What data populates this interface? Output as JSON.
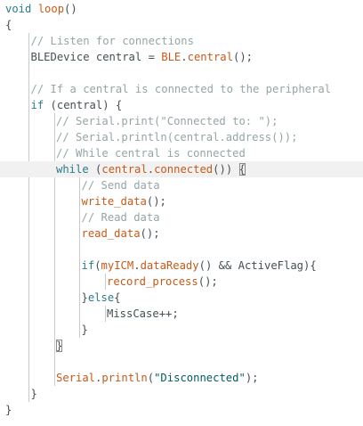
{
  "editor": {
    "lines": [
      {
        "indent": 0,
        "tokens": [
          {
            "t": "void ",
            "c": "kw"
          },
          {
            "t": "loop",
            "c": "fn"
          },
          {
            "t": "()",
            "c": "op"
          }
        ]
      },
      {
        "indent": 0,
        "tokens": [
          {
            "t": "{",
            "c": "op"
          }
        ]
      },
      {
        "indent": 1,
        "tokens": [
          {
            "t": "// Listen for connections",
            "c": "cm"
          }
        ]
      },
      {
        "indent": 1,
        "tokens": [
          {
            "t": "BLEDevice central = ",
            "c": "op"
          },
          {
            "t": "BLE",
            "c": "fn"
          },
          {
            "t": ".",
            "c": "op"
          },
          {
            "t": "central",
            "c": "fn"
          },
          {
            "t": "();",
            "c": "op"
          }
        ]
      },
      {
        "indent": 0,
        "tokens": []
      },
      {
        "indent": 1,
        "tokens": [
          {
            "t": "// If a central is connected to the peripheral",
            "c": "cm"
          }
        ]
      },
      {
        "indent": 1,
        "tokens": [
          {
            "t": "if",
            "c": "kw"
          },
          {
            "t": " (central) {",
            "c": "op"
          }
        ]
      },
      {
        "indent": 2,
        "tokens": [
          {
            "t": "// Serial.print(\"Connected to: \");",
            "c": "cm"
          }
        ]
      },
      {
        "indent": 2,
        "tokens": [
          {
            "t": "// Serial.println(central.address());",
            "c": "cm"
          }
        ]
      },
      {
        "indent": 2,
        "tokens": [
          {
            "t": "// While central is connected",
            "c": "cm"
          }
        ]
      },
      {
        "indent": 2,
        "active": true,
        "tokens": [
          {
            "t": "while",
            "c": "kw"
          },
          {
            "t": " (",
            "c": "op"
          },
          {
            "t": "central",
            "c": "fn"
          },
          {
            "t": ".",
            "c": "op"
          },
          {
            "t": "connected",
            "c": "fn"
          },
          {
            "t": "()) ",
            "c": "op"
          },
          {
            "t": "{",
            "c": "op",
            "match": true
          }
        ]
      },
      {
        "indent": 3,
        "tokens": [
          {
            "t": "// Send data",
            "c": "cm"
          }
        ]
      },
      {
        "indent": 3,
        "tokens": [
          {
            "t": "write_data",
            "c": "fn"
          },
          {
            "t": "();",
            "c": "op"
          }
        ]
      },
      {
        "indent": 3,
        "tokens": [
          {
            "t": "// Read data",
            "c": "cm"
          }
        ]
      },
      {
        "indent": 3,
        "tokens": [
          {
            "t": "read_data",
            "c": "fn"
          },
          {
            "t": "();",
            "c": "op"
          }
        ]
      },
      {
        "indent": 0,
        "tokens": []
      },
      {
        "indent": 3,
        "tokens": [
          {
            "t": "if",
            "c": "kw"
          },
          {
            "t": "(",
            "c": "op"
          },
          {
            "t": "myICM",
            "c": "fn"
          },
          {
            "t": ".",
            "c": "op"
          },
          {
            "t": "dataReady",
            "c": "fn"
          },
          {
            "t": "() && ActiveFlag){",
            "c": "op"
          }
        ]
      },
      {
        "indent": 4,
        "tokens": [
          {
            "t": "record_process",
            "c": "fn"
          },
          {
            "t": "();",
            "c": "op"
          }
        ]
      },
      {
        "indent": 3,
        "tokens": [
          {
            "t": "}",
            "c": "op"
          },
          {
            "t": "else",
            "c": "kw"
          },
          {
            "t": "{",
            "c": "op"
          }
        ]
      },
      {
        "indent": 4,
        "tokens": [
          {
            "t": "MissCase++;",
            "c": "op"
          }
        ]
      },
      {
        "indent": 3,
        "tokens": [
          {
            "t": "}",
            "c": "op"
          }
        ]
      },
      {
        "indent": 2,
        "tokens": [
          {
            "t": "}",
            "c": "op",
            "match": true
          }
        ]
      },
      {
        "indent": 0,
        "tokens": []
      },
      {
        "indent": 2,
        "tokens": [
          {
            "t": "Serial",
            "c": "fn"
          },
          {
            "t": ".",
            "c": "op"
          },
          {
            "t": "println",
            "c": "fn"
          },
          {
            "t": "(",
            "c": "op"
          },
          {
            "t": "\"Disconnected\"",
            "c": "str"
          },
          {
            "t": ");",
            "c": "op"
          }
        ]
      },
      {
        "indent": 1,
        "tokens": [
          {
            "t": "}",
            "c": "op"
          }
        ]
      },
      {
        "indent": 0,
        "tokens": [
          {
            "t": "}",
            "c": "op"
          }
        ]
      }
    ]
  },
  "colors": {
    "keyword": "#2b7a8c",
    "function": "#c45a19",
    "comment": "#95a5a6",
    "string": "#005c5f",
    "text": "#333333",
    "active_line": "#f1f1f1"
  }
}
